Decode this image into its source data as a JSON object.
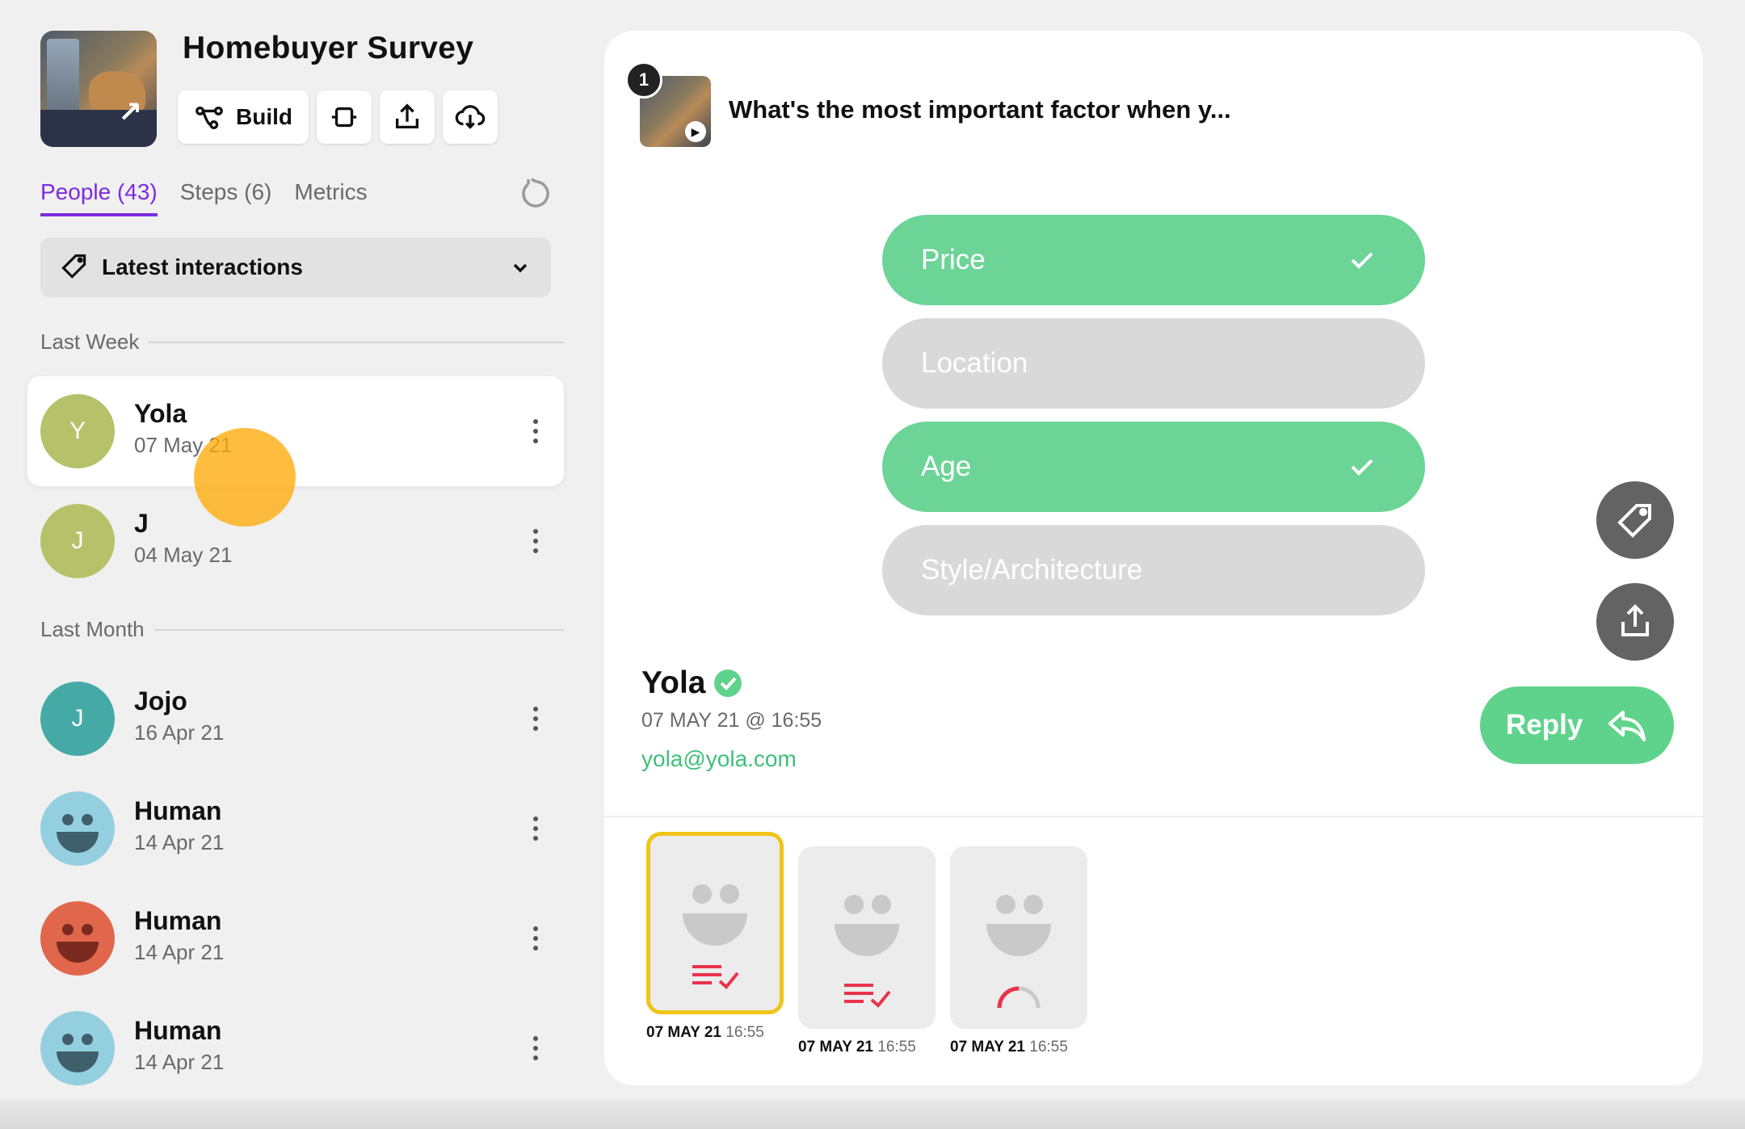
{
  "survey": {
    "title": "Homebuyer Survey",
    "build_label": "Build"
  },
  "tabs": [
    {
      "label": "People (43)",
      "active": true
    },
    {
      "label": "Steps (6)",
      "active": false
    },
    {
      "label": "Metrics",
      "active": false
    }
  ],
  "filter": {
    "label": "Latest interactions"
  },
  "sections": [
    {
      "label": "Last Week"
    },
    {
      "label": "Last Month"
    }
  ],
  "people": [
    {
      "initial": "Y",
      "name": "Yola",
      "date": "07 May 21",
      "color": "#b5c26a",
      "selected": true
    },
    {
      "initial": "J",
      "name": "J",
      "date": "04 May 21",
      "color": "#b5c26a",
      "selected": false
    },
    {
      "initial": "J",
      "name": "Jojo",
      "date": "16 Apr 21",
      "color": "#45aaa6",
      "selected": false
    },
    {
      "initial": "",
      "name": "Human",
      "date": "14 Apr 21",
      "color": "#94cfe0",
      "selected": false
    },
    {
      "initial": "",
      "name": "Human",
      "date": "14 Apr 21",
      "color": "#e0664c",
      "selected": false
    },
    {
      "initial": "",
      "name": "Human",
      "date": "14 Apr 21",
      "color": "#94cfe0",
      "selected": false
    }
  ],
  "question": {
    "number": "1",
    "text": "What's the most important factor when y..."
  },
  "options": [
    {
      "label": "Price",
      "selected": true
    },
    {
      "label": "Location",
      "selected": false
    },
    {
      "label": "Age",
      "selected": true
    },
    {
      "label": "Style/Architecture",
      "selected": false
    }
  ],
  "respondent": {
    "name": "Yola",
    "timestamp": "07 MAY 21 @ 16:55",
    "email": "yola@yola.com"
  },
  "reply_label": "Reply",
  "responses": [
    {
      "date": "07 MAY 21",
      "time": "16:55",
      "kind": "multiple-choice",
      "selected": true
    },
    {
      "date": "07 MAY 21",
      "time": "16:55",
      "kind": "multiple-choice",
      "selected": false
    },
    {
      "date": "07 MAY 21",
      "time": "16:55",
      "kind": "rating",
      "selected": false
    }
  ],
  "colors": {
    "accent": "#7b2be0",
    "selected_option": "#6dd497",
    "unselected_option": "#d9d9d9",
    "reply": "#5fd38c",
    "email": "#3fc07a",
    "highlight": "#f0c419"
  }
}
